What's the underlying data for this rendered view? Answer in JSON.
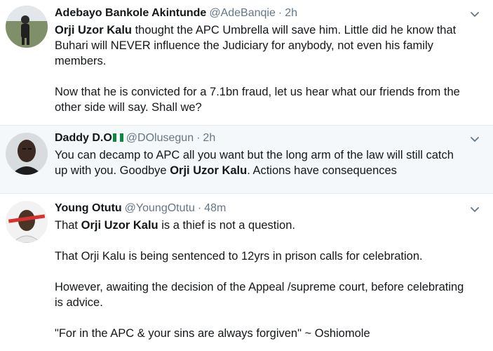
{
  "tweets": [
    {
      "name": "Adebayo Bankole Akintunde",
      "handle": "@AdeBanqie",
      "sep": "·",
      "time": "2h",
      "p1a": "Orji Uzor Kalu",
      "p1b": " thought the APC Umbrella will save him. Little did he know that Buhari will NEVER influence the Judiciary for anybody, not even his family members.",
      "p2": "Now that he is convicted for a 7.1bn fraud, let us hear what our friends from the other side will say. Shall we?"
    },
    {
      "name": "Daddy D.O",
      "flag_icon": "nigeria-flag-icon",
      "handle": "@DOlusegun",
      "sep": "·",
      "time": "2h",
      "p1a": "You can decamp to APC all you want but the long arm of the law will still catch up with you. Goodbye ",
      "p1b": "Orji Uzor Kalu",
      "p1c": ". Actions have consequences"
    },
    {
      "name": "Young Otutu",
      "handle": "@YoungOtutu",
      "sep": "·",
      "time": "48m",
      "p1a": "That ",
      "p1b": "Orji Uzor Kalu",
      "p1c": " is a thief is not a question.",
      "p2": "That Orji Kalu is being sentenced to 12yrs in prison calls for celebration.",
      "p3": "However, awaiting the decision of the Appeal /supreme court, before celebrating is advice.",
      "p4": "\"For in the APC & your sins are always forgiven\" ~ Oshiomole"
    }
  ],
  "colors": {
    "text": "#14171a",
    "muted": "#657786",
    "highlight_bg": "#f5f8fa"
  }
}
